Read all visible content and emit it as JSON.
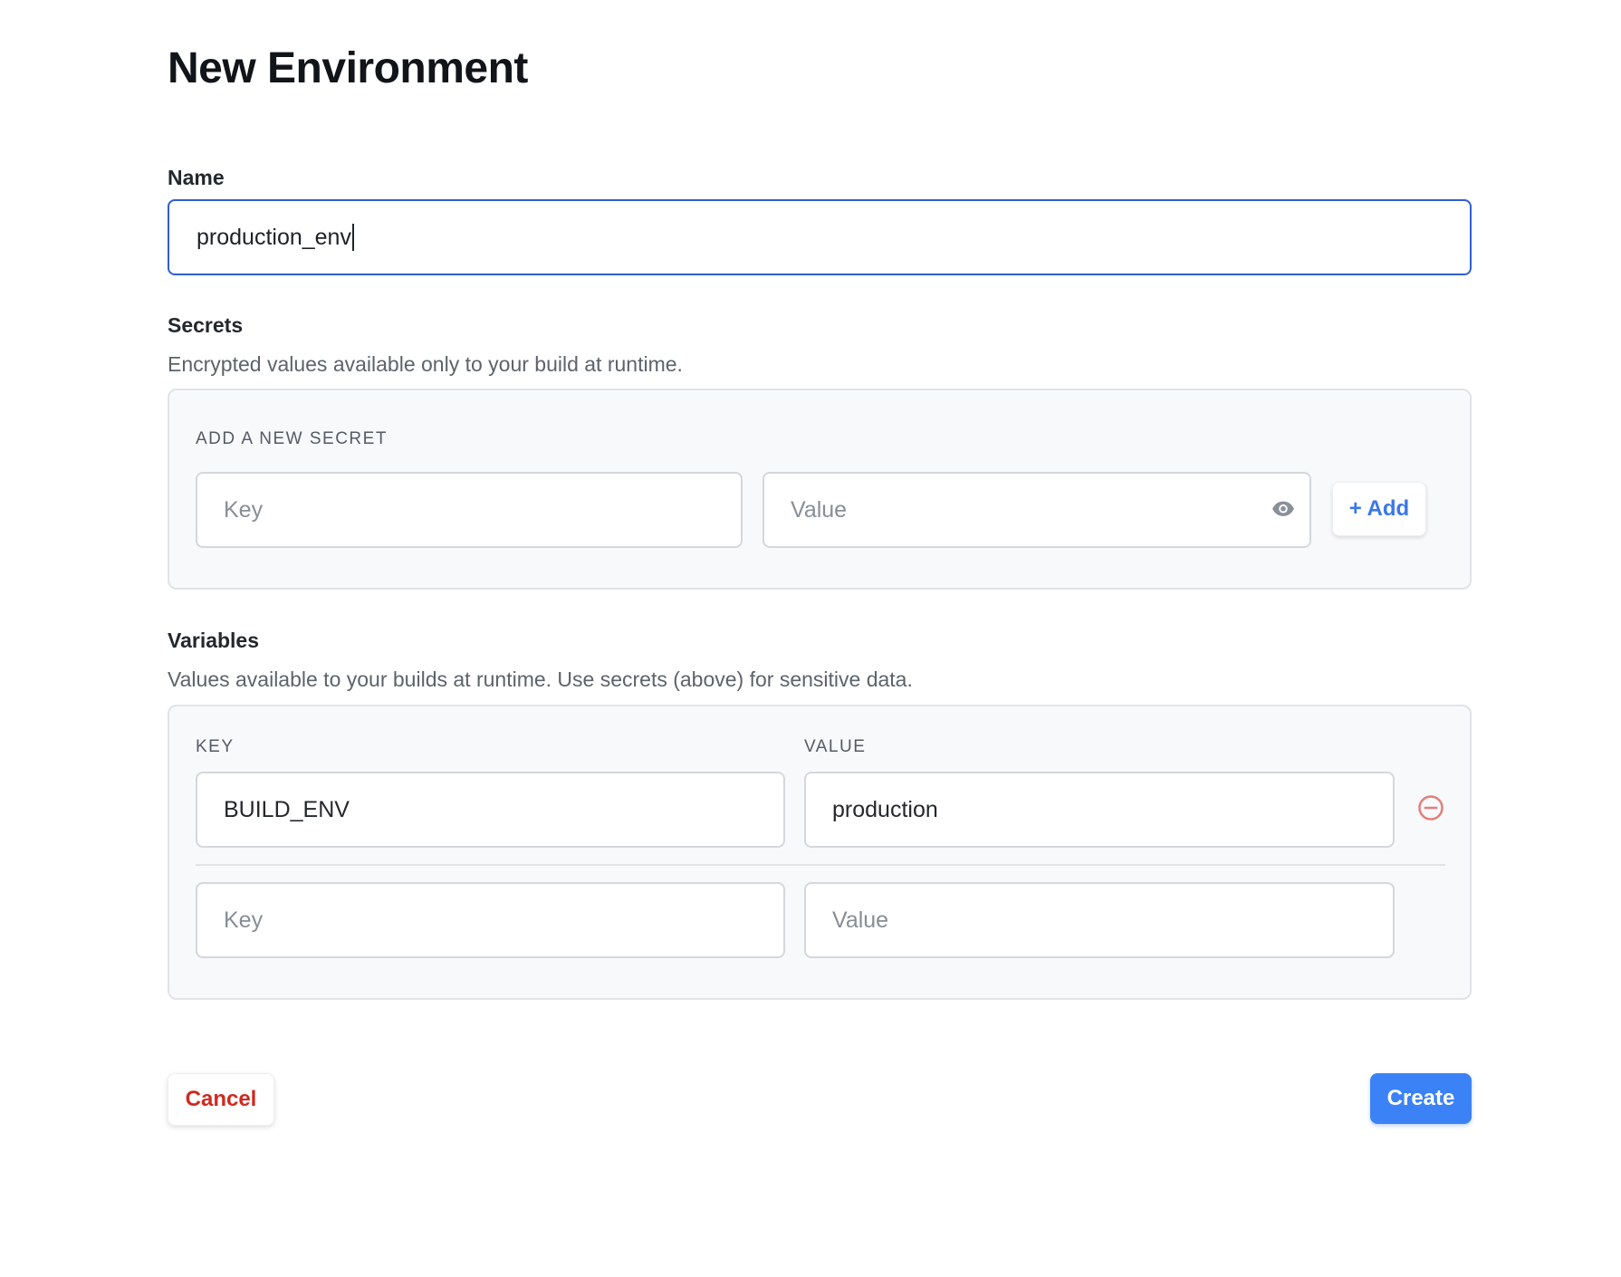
{
  "page_title": "New Environment",
  "name_section": {
    "label": "Name",
    "value": "production_env"
  },
  "secrets": {
    "label": "Secrets",
    "description": "Encrypted values available only to your build at runtime.",
    "panel_heading": "ADD A NEW SECRET",
    "key_placeholder": "Key",
    "value_placeholder": "Value",
    "add_label": "+ Add"
  },
  "variables": {
    "label": "Variables",
    "description": "Values available to your builds at runtime. Use secrets (above) for sensitive data.",
    "key_header": "KEY",
    "value_header": "VALUE",
    "rows": [
      {
        "key": "BUILD_ENV",
        "value": "production"
      }
    ],
    "new_key_placeholder": "Key",
    "new_value_placeholder": "Value"
  },
  "actions": {
    "cancel_label": "Cancel",
    "create_label": "Create"
  },
  "colors": {
    "primary": "#3b82f6",
    "danger": "#cf2a1f",
    "focus_border": "#2f5fd0"
  },
  "icons": {
    "reveal": "eye-icon",
    "remove": "minus-circle-icon"
  }
}
